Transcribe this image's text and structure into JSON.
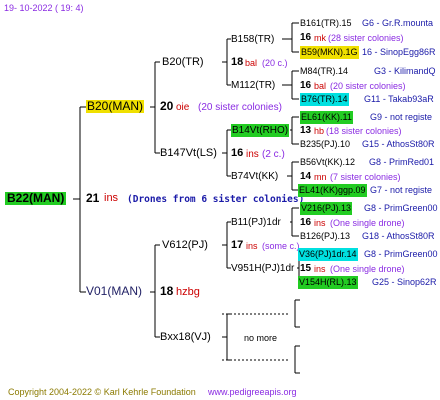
{
  "header": {
    "date": "19-  10-2022  ( 19:   4)"
  },
  "footer": {
    "copyright": "Copyright 2004-2022 © Karl Kehrle Foundation",
    "site": "www.pedigreeapis.org"
  },
  "colors": {
    "green": "#22cc22",
    "yellow": "#f0e000",
    "cyan": "#00e0e0",
    "blue": "#1a1aa8",
    "red": "#cc0000"
  },
  "root": {
    "id": "B22(MAN)",
    "num": "21",
    "ins": "ins",
    "drones": "(Drones from 6 sister colonies)"
  },
  "gen1": [
    {
      "id": "B20(MAN)",
      "num": "20",
      "tag": "oie",
      "note": "(20 sister colonies)"
    },
    {
      "id": "V01(MAN)",
      "num": "18",
      "tag": "hzbg"
    }
  ],
  "gen2": [
    {
      "id": "B20(TR)"
    },
    {
      "id": "B147Vt(LS)",
      "num": "16",
      "tag": "ins",
      "note": "(2 c.)"
    },
    {
      "id": "V612(PJ)",
      "num": "17",
      "tag": "ins",
      "note": "(some c.)"
    },
    {
      "id": "Bxx18(VJ)",
      "more": "no more"
    }
  ],
  "gen3": [
    {
      "id": "B158(TR)",
      "num": "18",
      "tag": "bal",
      "note": "(20 c.)"
    },
    {
      "id": "M112(TR)"
    },
    {
      "id": "B14Vt(RHO)",
      "num": "13",
      "tag": "hb",
      "note": "(18 sister colonies)"
    },
    {
      "id": "B74Vt(KK)",
      "num": "14",
      "tag": "mn",
      "note": "(7 sister colonies)"
    },
    {
      "id": "B11(PJ)1dr",
      "num": "16",
      "tag": "ins",
      "note": "(One single drone)"
    },
    {
      "id": "V951H(PJ)1dr",
      "num": "15",
      "tag": "ins",
      "note": "(One single drone)"
    }
  ],
  "gen4": [
    {
      "id": "B161(TR).15",
      "ref": "G6 - Gr.R.mounta",
      "num": "16",
      "tag": "mk",
      "note": "(28 sister colonies)"
    },
    {
      "id": "B59(MKN).1G",
      "ref": "16 - SinopEgg86R"
    },
    {
      "id": "M84(TR).14",
      "ref": "G3 - KilimandQ",
      "num": "16",
      "tag": "bal",
      "note": "(20 sister colonies)"
    },
    {
      "id": "B76(TR).14",
      "ref": "G11 - Takab93aR"
    },
    {
      "id": "EL61(KK).11",
      "ref": "G9 - not registe"
    },
    {
      "id": "B235(PJ).10",
      "ref": "G15 - AthosSt80R"
    },
    {
      "id": "B56Vt(KK).12",
      "ref": "G8 - PrimRed01"
    },
    {
      "id": "EL41(KK)ggp.09",
      "ref": "G7 - not registe"
    },
    {
      "id": "V216(PJ).13",
      "ref": "G8 - PrimGreen00"
    },
    {
      "id": "B126(PJ).13",
      "ref": "G18 - AthosSt80R"
    },
    {
      "id": "V36(PJ)1dr.14",
      "ref": "G8 - PrimGreen00"
    },
    {
      "id": "V154H(RL).13",
      "ref": "G25 - Sinop62R"
    }
  ]
}
